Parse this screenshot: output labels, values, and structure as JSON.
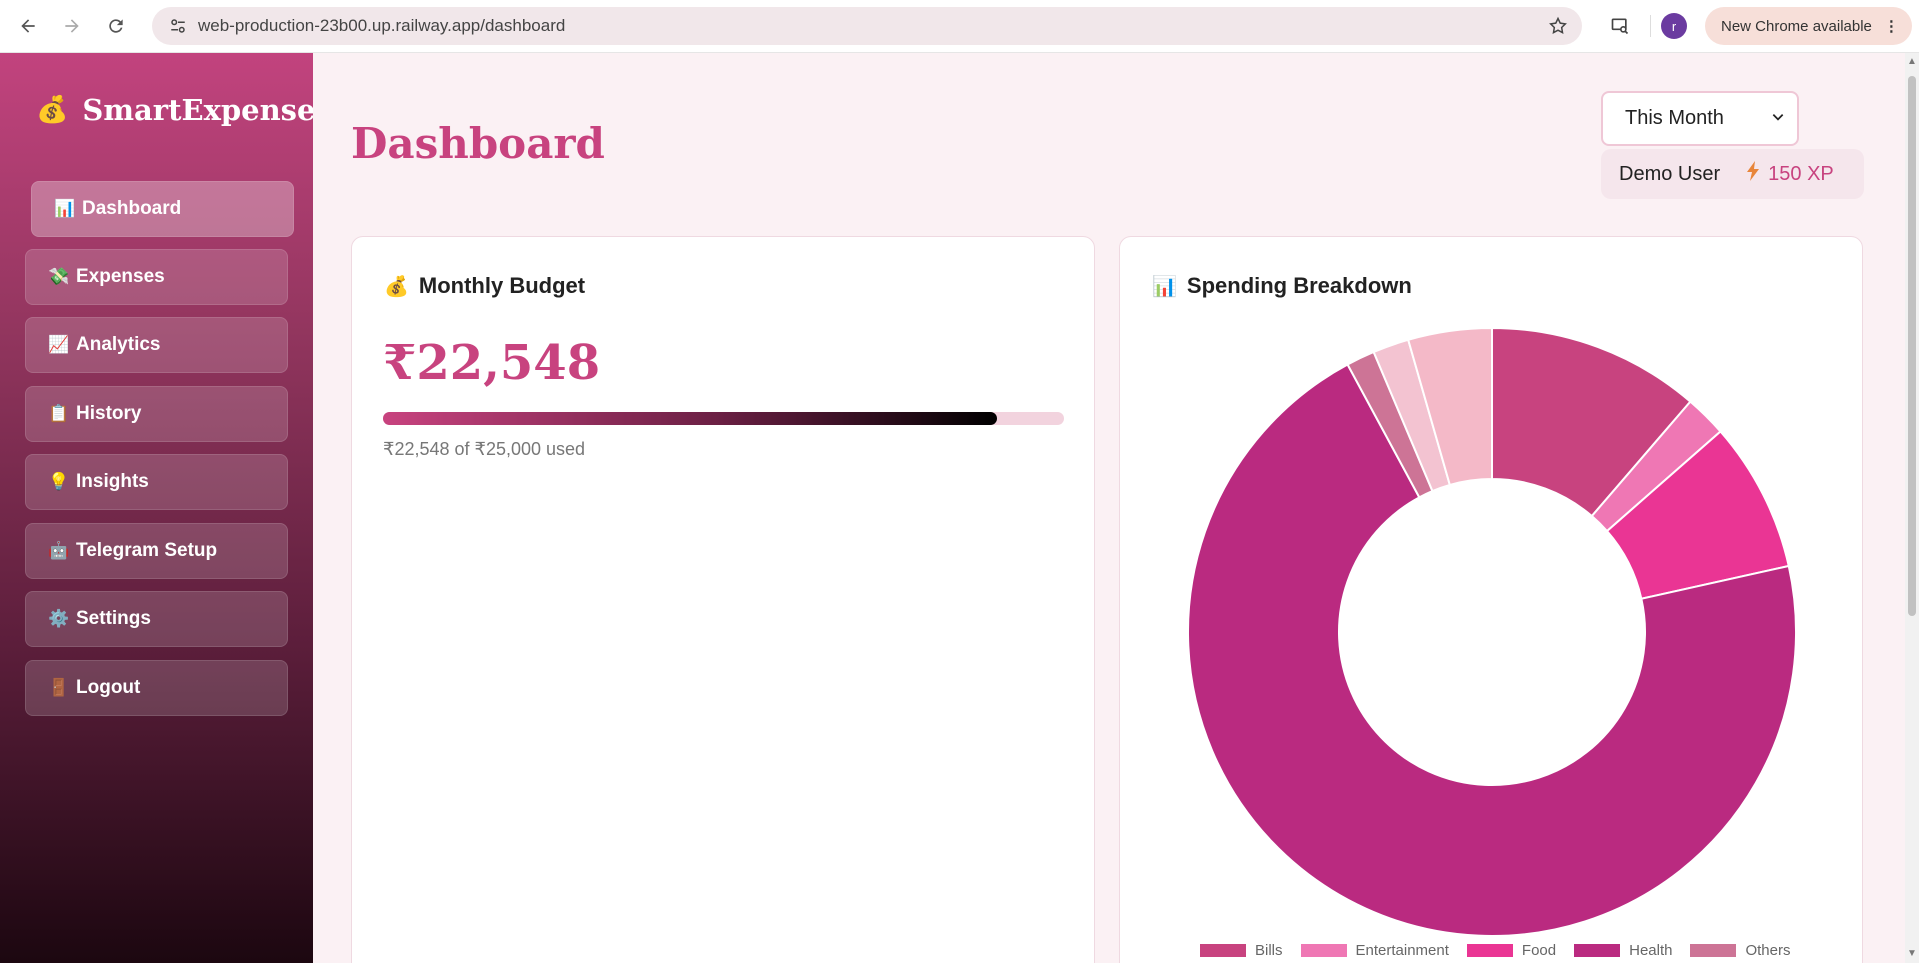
{
  "browser": {
    "url": "web-production-23b00.up.railway.app/dashboard",
    "profile_initial": "r",
    "update_label": "New Chrome available"
  },
  "sidebar": {
    "brand_emoji": "💰",
    "brand_name": "SmartExpense",
    "items": [
      {
        "icon": "📊",
        "label": "Dashboard",
        "active": true
      },
      {
        "icon": "💸",
        "label": "Expenses"
      },
      {
        "icon": "📈",
        "label": "Analytics"
      },
      {
        "icon": "📋",
        "label": "History"
      },
      {
        "icon": "💡",
        "label": "Insights"
      },
      {
        "icon": "🤖",
        "label": "Telegram Setup"
      },
      {
        "icon": "⚙️",
        "label": "Settings"
      },
      {
        "icon": "🚪",
        "label": "Logout"
      }
    ]
  },
  "header": {
    "title": "Dashboard",
    "period": "This Month",
    "user_name": "Demo User",
    "xp": "150 XP"
  },
  "budget": {
    "icon": "💰",
    "title": "Monthly Budget",
    "amount": "₹22,548",
    "used_text": "₹22,548 of ₹25,000 used",
    "progress_fraction": 0.902
  },
  "spending": {
    "icon": "📊",
    "title": "Spending Breakdown"
  },
  "chart_data": {
    "type": "pie",
    "donut": true,
    "categories": [
      "Bills",
      "Entertainment",
      "Food",
      "Health",
      "Others"
    ],
    "series": [
      {
        "values": [
          11.2,
          2.2,
          7.9,
          69.9,
          1.5,
          1.9,
          4.4
        ]
      }
    ],
    "slice_labels": [
      "Bills",
      "Entertainment",
      "Food",
      "Health",
      "Others",
      "",
      ""
    ],
    "colors": [
      "#c8437f",
      "#ef77b4",
      "#ea3594",
      "#ba2a80",
      "#cd7496",
      "#f3c3d1",
      "#f4b9c8"
    ],
    "legend_position": "bottom"
  }
}
